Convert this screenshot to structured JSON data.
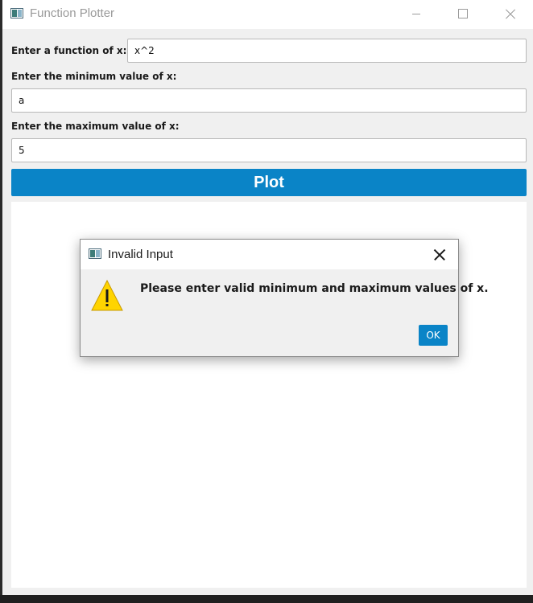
{
  "window": {
    "title": "Function Plotter"
  },
  "form": {
    "function_label": "Enter a function of x:",
    "function_value": "x^2",
    "min_label": "Enter the minimum value of x:",
    "min_value": "a",
    "max_label": "Enter the maximum value of x:",
    "max_value": "5",
    "plot_label": "Plot"
  },
  "dialog": {
    "title": "Invalid Input",
    "message": "Please enter valid minimum and maximum values of x.",
    "ok_label": "OK",
    "icon": "warning-icon"
  },
  "colors": {
    "accent": "#0a84c7",
    "window_bg": "#f0f0f0",
    "warning": "#ffd400"
  }
}
